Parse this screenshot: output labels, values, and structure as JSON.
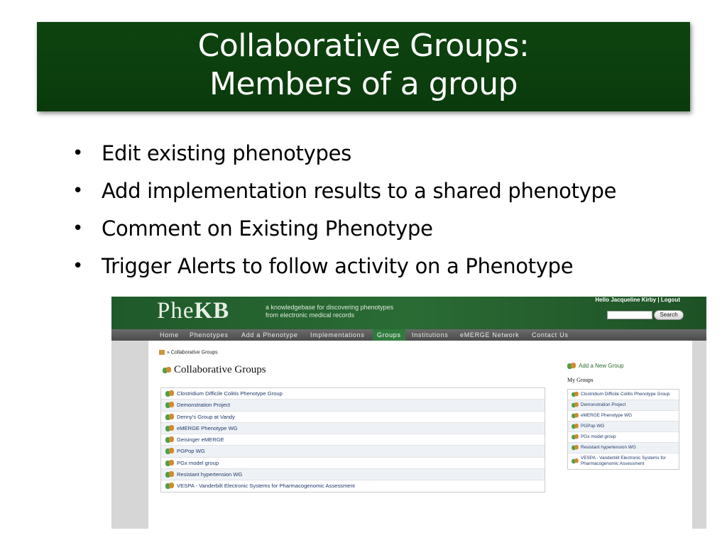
{
  "slide": {
    "title_line1": "Collaborative Groups:",
    "title_line2": "Members of a group",
    "bullets": [
      "Edit existing phenotypes",
      "Add implementation results to a shared phenotype",
      "Comment on Existing Phenotype",
      "Trigger Alerts to follow activity on a Phenotype"
    ],
    "colors": {
      "title_bg": "#0e4410",
      "title_text": "#ffffff"
    }
  },
  "site": {
    "logo_prefix": "Phe",
    "logo_bold": "KB",
    "tagline_line1": "a knowledgebase for discovering phenotypes",
    "tagline_line2": "from electronic medical records",
    "hello_text": "Hello Jacqueline Kirby | Logout",
    "search_placeholder": "",
    "search_button": "Search",
    "nav": [
      "Home",
      "Phenotypes",
      "Add a Phenotype",
      "Implementations",
      "Groups",
      "Institutions",
      "eMERGE Network",
      "Contact Us"
    ],
    "active_nav": "Groups",
    "breadcrumb_sep": "»",
    "breadcrumb_current": "Collaborative Groups",
    "page_heading": "Collaborative Groups",
    "groups": [
      "Clostridium Difficile Colitis Phenotype Group",
      "Demonstration Project",
      "Denny's Group at Vandy",
      "eMERGE Phenotype WG",
      "Geisinger eMERGE",
      "PGPop WG",
      "PGx model group",
      "Resistant hypertension WG",
      "VESPA - Vanderbilt Electronic Systems for Pharmacogenomic Assessment"
    ],
    "add_group_label": "Add a New Group",
    "my_groups_label": "My Groups",
    "my_groups": [
      "Clostridium Difficile Colitis Phenotype Group",
      "Demonstration Project",
      "eMERGE Phenotype WG",
      "PGPop WG",
      "PGx model group",
      "Resistant hypertension WG",
      "VESPA - Vanderbilt Electronic Systems for Pharmacogenomic Assessment"
    ]
  }
}
